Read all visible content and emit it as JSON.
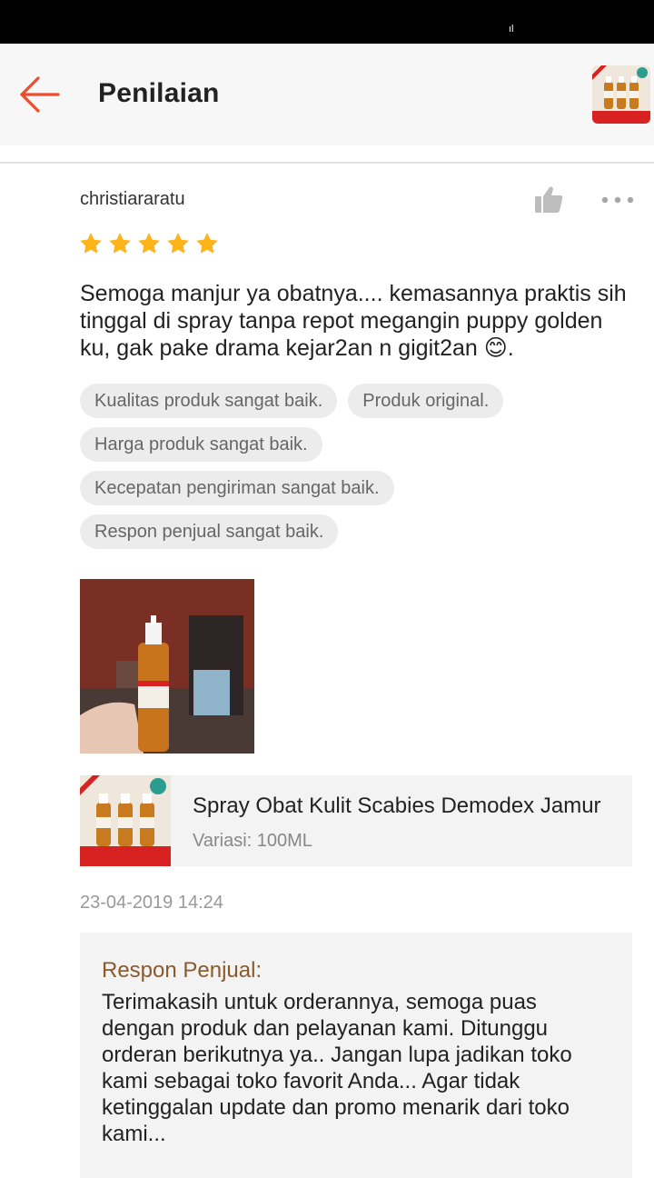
{
  "header": {
    "title": "Penilaian"
  },
  "review": {
    "username": "christiararatu",
    "rating": 5,
    "comment": "Semoga manjur ya obatnya.... kemasannya praktis sih tinggal di spray tanpa repot megangin puppy golden ku, gak pake drama kejar2an n gigit2an 😊.",
    "tags": [
      "Kualitas produk sangat baik.",
      "Produk original.",
      "Harga produk sangat baik.",
      "Kecepatan pengiriman sangat baik.",
      "Respon penjual sangat baik."
    ],
    "timestamp": "23-04-2019 14:24"
  },
  "product": {
    "name": "Spray Obat Kulit Scabies Demodex Jamur",
    "variation": "Variasi: 100ML"
  },
  "seller_response": {
    "label": "Respon Penjual:",
    "text": "Terimakasih untuk orderannya, semoga puas dengan produk dan pelayanan kami. Ditunggu orderan berikutnya ya.. Jangan lupa jadikan toko kami sebagai toko favorit Anda... Agar tidak ketinggalan update dan promo menarik dari toko kami..."
  },
  "colors": {
    "accent": "#ee4d2d",
    "star": "#ffb31a",
    "seller_label": "#8a5a2b"
  },
  "icons": {
    "back": "arrow-left-icon",
    "like": "thumbs-up-icon",
    "more": "more-dots-icon",
    "star": "star-icon"
  }
}
